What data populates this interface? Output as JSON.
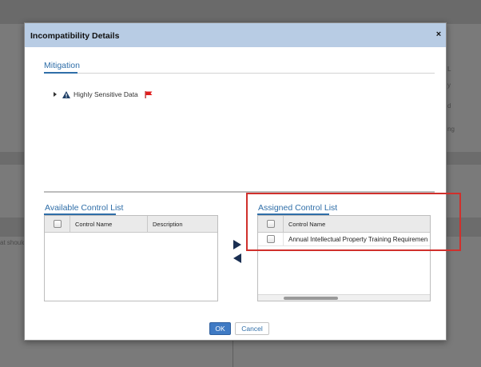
{
  "background": {
    "left_text": "at should",
    "right_texts": [
      "L",
      "y",
      "d",
      "ng"
    ]
  },
  "dialog": {
    "title": "Incompatibility Details",
    "close_label": "×"
  },
  "mitigation": {
    "tab_label": "Mitigation",
    "tree": [
      {
        "label": "Highly Sensitive Data",
        "expanded": false,
        "icons": [
          "warning-icon",
          "red-flag-icon"
        ]
      }
    ]
  },
  "available": {
    "title": "Available Control List",
    "columns": [
      "",
      "Control Name",
      "Description"
    ],
    "rows": []
  },
  "assigned": {
    "title": "Assigned Control List",
    "columns": [
      "",
      "Control Name"
    ],
    "rows": [
      {
        "name": "Annual Intellectual Property Training Requiremen"
      }
    ]
  },
  "buttons": {
    "ok": "OK",
    "cancel": "Cancel"
  },
  "colors": {
    "header_bg": "#b8cce4",
    "accent": "#2f6ea8",
    "ok_button": "#3f7ac4",
    "highlight": "#d0302c",
    "flag": "#e01e1e"
  }
}
